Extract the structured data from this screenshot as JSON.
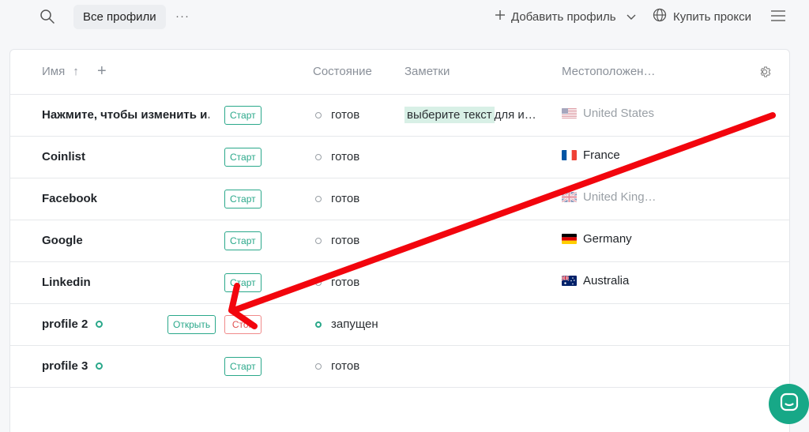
{
  "topbar": {
    "search_icon": "search-icon",
    "tab_label": "Все профили",
    "more_label": "···",
    "add_profile_label": "Добавить профиль",
    "buy_proxy_label": "Купить прокси"
  },
  "table": {
    "headers": {
      "name": "Имя",
      "state": "Состояние",
      "notes": "Заметки",
      "location": "Местоположен…"
    },
    "rows": [
      {
        "name": "Нажмите, чтобы изменить и…",
        "button": "Старт",
        "state": "готов",
        "note_highlight": "выберите текст",
        "note_rest": " для и…",
        "location": "United States",
        "flag": "us",
        "loc_muted": true
      },
      {
        "name": "Coinlist",
        "button": "Старт",
        "state": "готов",
        "note_highlight": "",
        "note_rest": "",
        "location": "France",
        "flag": "fr",
        "loc_muted": false
      },
      {
        "name": "Facebook",
        "button": "Старт",
        "state": "готов",
        "note_highlight": "",
        "note_rest": "",
        "location": "United King…",
        "flag": "gb",
        "loc_muted": true
      },
      {
        "name": "Google",
        "button": "Старт",
        "state": "готов",
        "note_highlight": "",
        "note_rest": "",
        "location": "Germany",
        "flag": "de",
        "loc_muted": false
      },
      {
        "name": "Linkedin",
        "button": "Старт",
        "state": "готов",
        "note_highlight": "",
        "note_rest": "",
        "location": "Australia",
        "flag": "au",
        "loc_muted": false
      },
      {
        "name": "profile 2",
        "button": "Стоп",
        "open_button": "Открыть",
        "state": "запущен",
        "running": true,
        "note_highlight": "",
        "note_rest": "",
        "location": "",
        "flag": ""
      },
      {
        "name": "profile 3",
        "button": "Старт",
        "state": "готов",
        "running_dot": true,
        "note_highlight": "",
        "note_rest": "",
        "location": "",
        "flag": ""
      }
    ]
  },
  "colors": {
    "accent": "#2aa88a",
    "annotation_arrow": "#f2050d",
    "chat_button": "#17a887"
  }
}
